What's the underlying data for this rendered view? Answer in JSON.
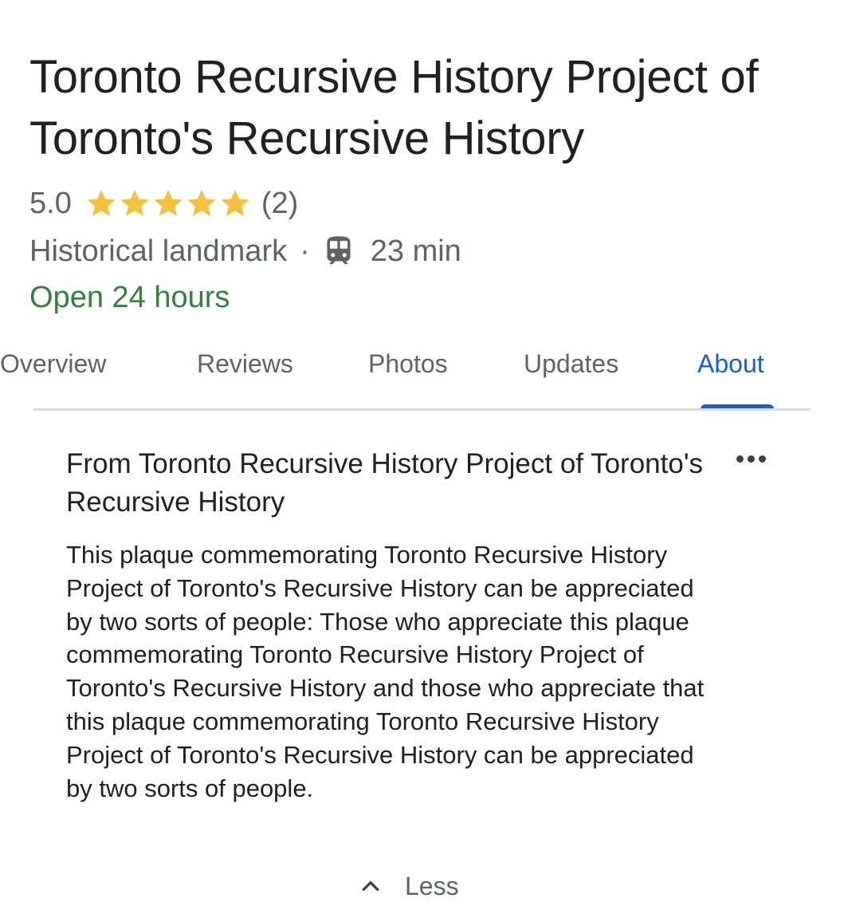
{
  "place": {
    "title": "Toronto Recursive History Project of Toronto's Recursive History",
    "rating": "5.0",
    "stars": 5,
    "review_count": "(2)",
    "category": "Historical landmark",
    "separator": "·",
    "transit_icon": "train-icon",
    "transit_time": "23 min",
    "hours": "Open 24 hours"
  },
  "tabs": [
    {
      "label": "Overview",
      "active": false
    },
    {
      "label": "Reviews",
      "active": false
    },
    {
      "label": "Photos",
      "active": false
    },
    {
      "label": "Updates",
      "active": false
    },
    {
      "label": "About",
      "active": true
    }
  ],
  "about": {
    "heading": "From Toronto Recursive History Project of Toronto's Recursive History",
    "more_icon": "more-horizontal-icon",
    "body": "This plaque commemorating Toronto Recursive History Project of Toronto's Recursive History can be appreciated by two sorts of people: Those who appreciate this plaque commemorating Toronto Recursive History Project of Toronto's Recursive History and those who appreciate that this plaque commemorating Toronto Recursive History Project of Toronto's Recursive History can be appreciated by two sorts of people.",
    "less_label": "Less",
    "less_icon": "chevron-up-icon"
  },
  "colors": {
    "accent": "#1a5fd0",
    "open_status": "#34803f",
    "star": "#f4c03e",
    "secondary_text": "#5f6368",
    "divider": "#dadce0"
  }
}
